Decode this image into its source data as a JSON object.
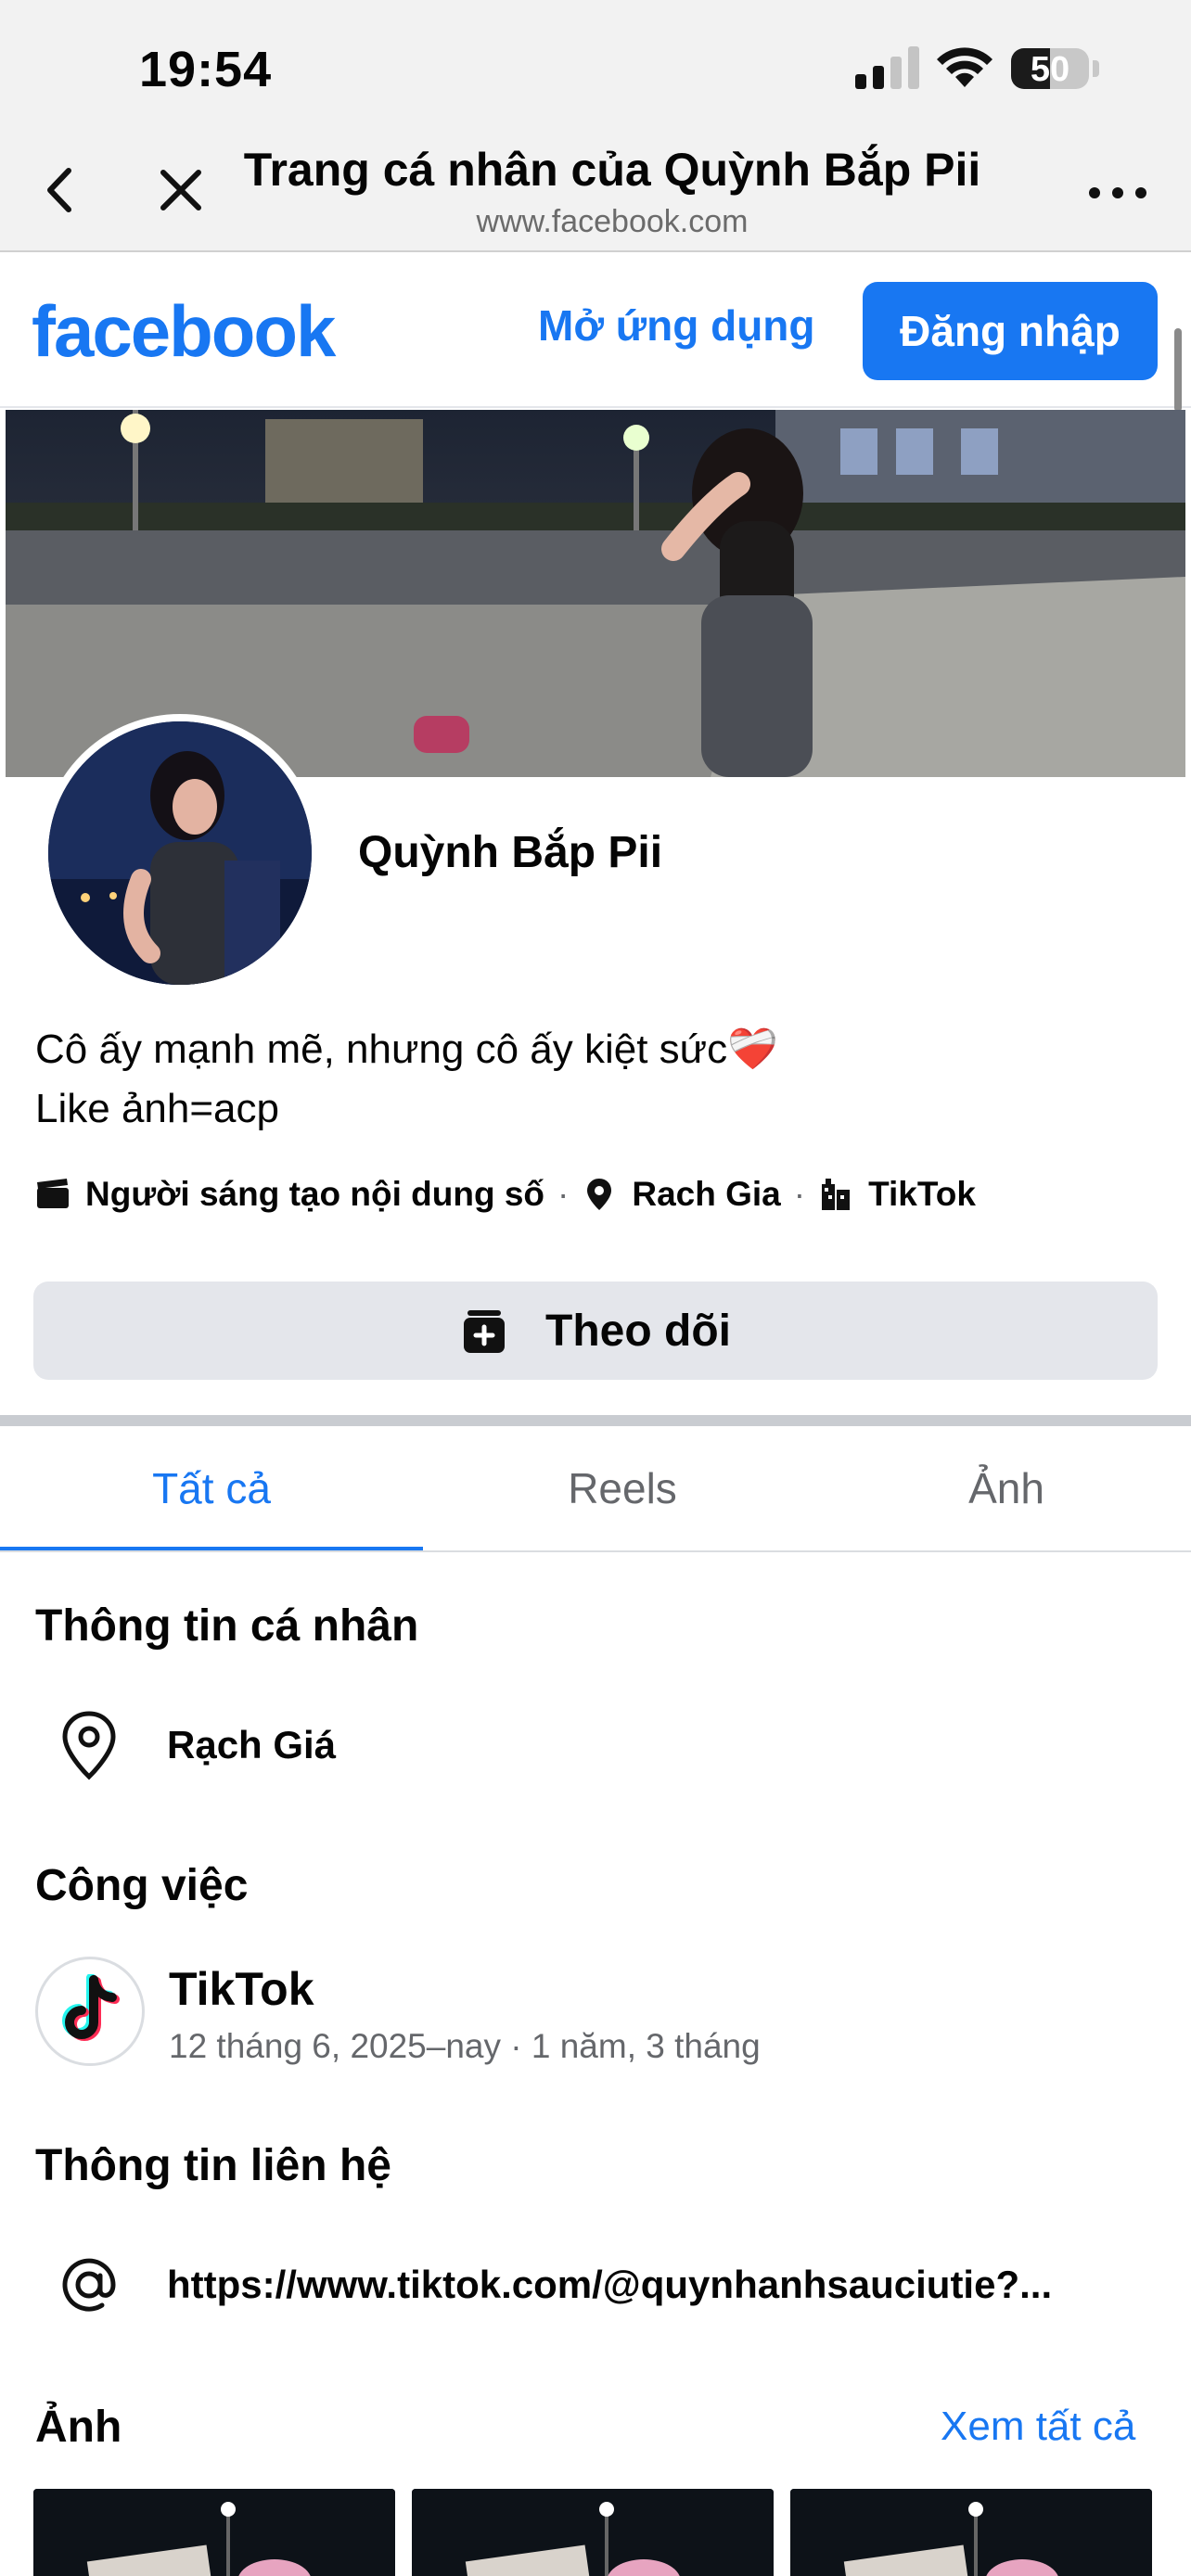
{
  "status_bar": {
    "time": "19:54",
    "battery": "50",
    "battery_level": 0.5,
    "signal_bars": 2
  },
  "browser": {
    "title": "Trang cá nhân của Quỳnh Bắp Pii",
    "url": "www.facebook.com",
    "icons": {
      "back": "chevron-left-icon",
      "close": "close-icon",
      "more": "more-horizontal-icon"
    }
  },
  "fb_header": {
    "logo": "facebook",
    "open_app": "Mở ứng dụng",
    "login": "Đăng nhập",
    "brand_color": "#1877f2"
  },
  "profile": {
    "name": "Quỳnh Bắp Pii",
    "bio_line1": "Cô ấy mạnh mẽ, nhưng cô ấy kiệt sức",
    "bio_emoji": "❤️‍🩹",
    "bio_line2": "Like ảnh=acp",
    "meta": {
      "category": "Người sáng tạo nội dung số",
      "city": "Rach Gia",
      "workplace": "TikTok",
      "separator": "·"
    },
    "follow": "Theo dõi"
  },
  "tabs": [
    {
      "label": "Tất cả",
      "active": true
    },
    {
      "label": "Reels",
      "active": false
    },
    {
      "label": "Ảnh",
      "active": false
    }
  ],
  "intro": {
    "personal_heading": "Thông tin cá nhân",
    "location": "Rạch Giá",
    "work_heading": "Công việc",
    "work_company": "TikTok",
    "work_dates": "12 tháng 6, 2025–nay · 1 năm, 3 tháng",
    "contact_heading": "Thông tin liên hệ",
    "contact_link": "https://www.tiktok.com/@quynhanhsauciutie?..."
  },
  "photos": {
    "heading": "Ảnh",
    "see_all": "Xem tất cả",
    "count_visible": 3
  }
}
